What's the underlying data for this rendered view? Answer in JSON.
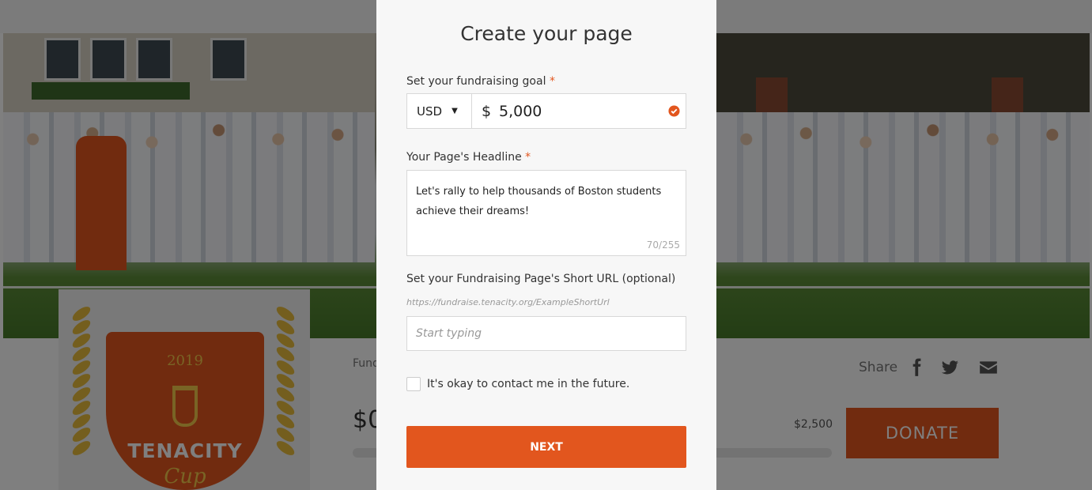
{
  "modal": {
    "title": "Create your page",
    "goal": {
      "label": "Set your fundraising goal",
      "required_mark": "*",
      "currency": "USD",
      "currency_symbol": "$",
      "amount": "5,000"
    },
    "headline": {
      "label": "Your Page's Headline",
      "required_mark": "*",
      "value": "Let's rally to help thousands of Boston students achieve their dreams!",
      "char_count": "70/255"
    },
    "short_url": {
      "label": "Set your Fundraising Page's Short URL (optional)",
      "hint": "https://fundraise.tenacity.org/ExampleShortUrl",
      "placeholder": "Start typing"
    },
    "contact_consent": {
      "label": "It's okay to contact me in the future.",
      "checked": false
    },
    "next_label": "NEXT"
  },
  "background": {
    "crest": {
      "year": "2019",
      "title": "TENACITY",
      "subtitle": "Cup"
    },
    "fund_label": "Fund",
    "raised_amount": "$0",
    "goal_amount": "$2,500",
    "donate_label": "DONATE",
    "share_label": "Share"
  },
  "colors": {
    "accent": "#e2561e",
    "overlay": "rgba(0,0,0,0.5)",
    "modal_bg": "#f7f7f7"
  },
  "icons": {
    "currency_caret": "caret-down-icon",
    "valid": "check-circle-icon",
    "share": [
      "facebook-icon",
      "twitter-icon",
      "envelope-icon"
    ]
  }
}
